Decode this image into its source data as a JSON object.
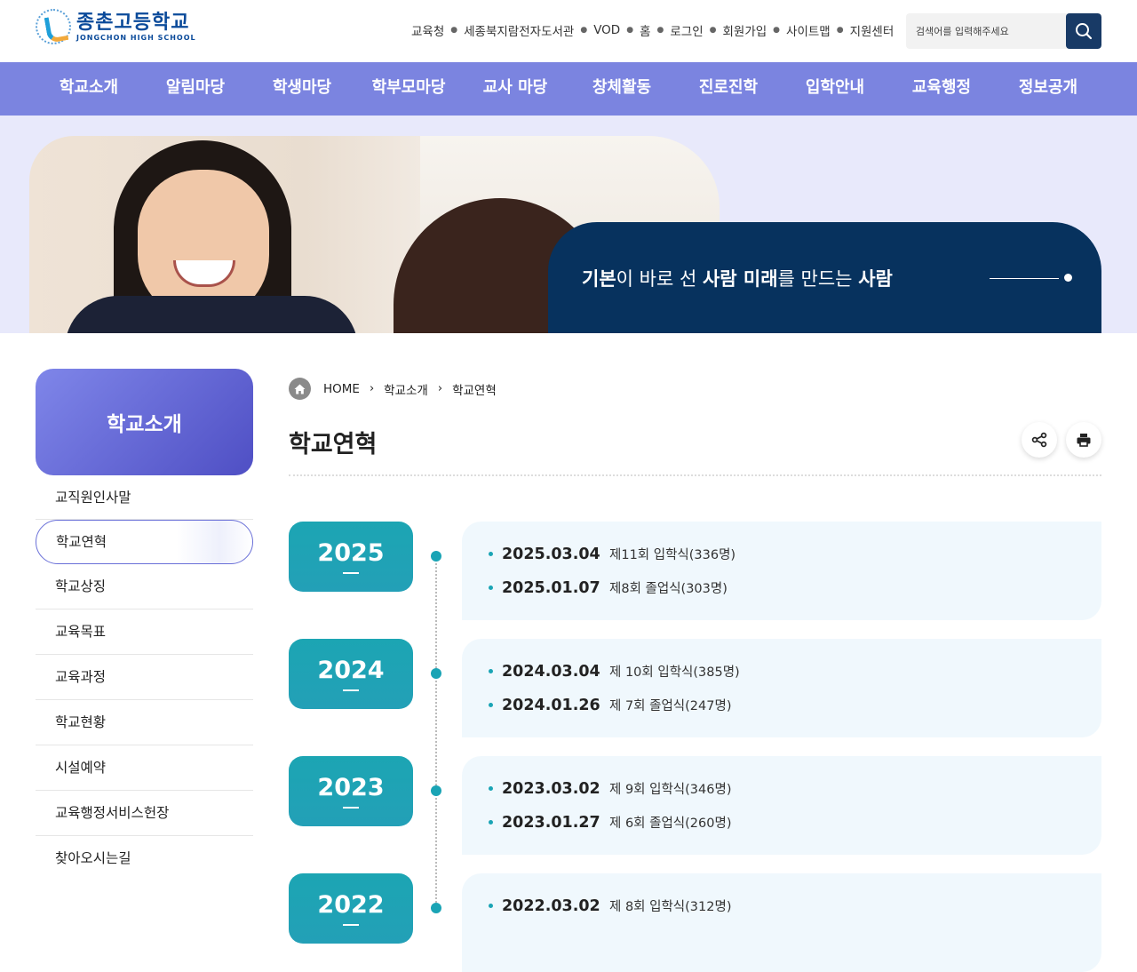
{
  "header": {
    "logo_ko": "종촌고등학교",
    "logo_en": "JONGCHON HIGH SCHOOL",
    "util_links": [
      "교육청",
      "세종북지람전자도서관",
      "VOD",
      "홈",
      "로그인",
      "회원가입",
      "사이트맵",
      "지원센터"
    ],
    "search_placeholder": "검색어를 입력해주세요"
  },
  "gnb": [
    "학교소개",
    "알림마당",
    "학생마당",
    "학부모마당",
    "교사 마당",
    "창체활동",
    "진로진학",
    "입학안내",
    "교육행정",
    "정보공개"
  ],
  "visual": {
    "slogan_parts": [
      {
        "text": "기본",
        "bold": true
      },
      {
        "text": "이 바로 선 ",
        "bold": false
      },
      {
        "text": "사람 미래",
        "bold": true
      },
      {
        "text": "를 만드는 ",
        "bold": false
      },
      {
        "text": "사람",
        "bold": true
      }
    ]
  },
  "lnb": {
    "title": "학교소개",
    "items": [
      "교직원인사말",
      "학교연혁",
      "학교상징",
      "교육목표",
      "교육과정",
      "학교현황",
      "시설예약",
      "교육행정서비스헌장",
      "찾아오시는길"
    ],
    "active_index": 1
  },
  "breadcrumb": [
    "HOME",
    "학교소개",
    "학교연혁"
  ],
  "page_title": "학교연혁",
  "timeline": [
    {
      "year": "2025",
      "events": [
        {
          "date": "2025.03.04",
          "text": "제11회 입학식(336명)"
        },
        {
          "date": "2025.01.07",
          "text": "제8회 졸업식(303명)"
        }
      ]
    },
    {
      "year": "2024",
      "events": [
        {
          "date": "2024.03.04",
          "text": "제 10회 입학식(385명)"
        },
        {
          "date": "2024.01.26",
          "text": "제 7회 졸업식(247명)"
        }
      ]
    },
    {
      "year": "2023",
      "events": [
        {
          "date": "2023.03.02",
          "text": "제 9회 입학식(346명)"
        },
        {
          "date": "2023.01.27",
          "text": "제 6회 졸업식(260명)"
        }
      ]
    },
    {
      "year": "2022",
      "events": [
        {
          "date": "2022.03.02",
          "text": "제 8회 입학식(312명)"
        }
      ]
    }
  ],
  "colors": {
    "gnb": "#7b84e0",
    "slogan_bg": "#07325e",
    "year_badge": "#1ca5b3",
    "search_button": "#183a66"
  }
}
